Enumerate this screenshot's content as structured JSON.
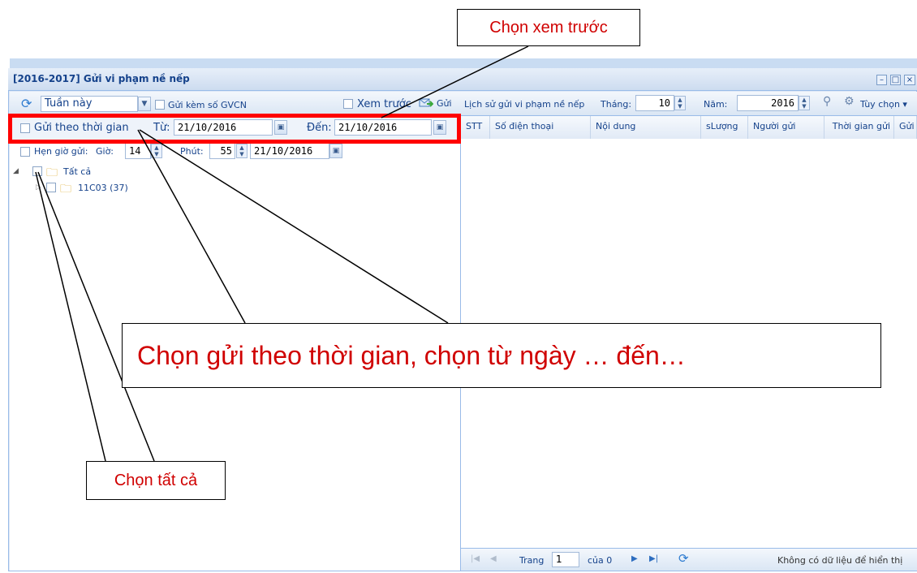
{
  "window": {
    "title": "[2016-2017] Gửi vi phạm nề nếp"
  },
  "toolbar": {
    "period": "Tuần này",
    "attach_gvcn": "Gửi kèm số GVCN",
    "preview": "Xem trước",
    "send": "Gửi",
    "history_title": "Lịch sử gửi vi phạm nề nếp",
    "month_label": "Tháng:",
    "month_value": "10",
    "year_label": "Năm:",
    "year_value": "2016",
    "options": "Tùy chọn"
  },
  "time_filter": {
    "send_by_time": "Gửi theo thời gian",
    "from_label": "Từ:",
    "from_value": "21/10/2016",
    "to_label": "Đến:",
    "to_value": "21/10/2016"
  },
  "schedule": {
    "label": "Hẹn giờ gửi:",
    "hour_label": "Giờ:",
    "hour_value": "14",
    "minute_label": "Phút:",
    "minute_value": "55",
    "date_value": "21/10/2016"
  },
  "tree": {
    "root": "Tất cả",
    "children": [
      "11C03 (37)"
    ]
  },
  "grid": {
    "columns": [
      "STT",
      "Số điện thoại",
      "Nội dung",
      "sLượng",
      "Người gửi",
      "Thời gian gửi",
      "Gửi"
    ]
  },
  "pager": {
    "page_label": "Trang",
    "page_value": "1",
    "of_label": "của 0",
    "empty_msg": "Không có dữ liệu để hiển thị"
  },
  "annotations": {
    "preview_callout": "Chọn xem trước",
    "time_callout": "Chọn gửi theo thời gian, chọn từ ngày … đến…",
    "select_all_callout": "Chọn tất cả"
  },
  "colors": {
    "accent": "#15428b",
    "highlight": "#ff0000",
    "callout_text": "#d00000"
  }
}
